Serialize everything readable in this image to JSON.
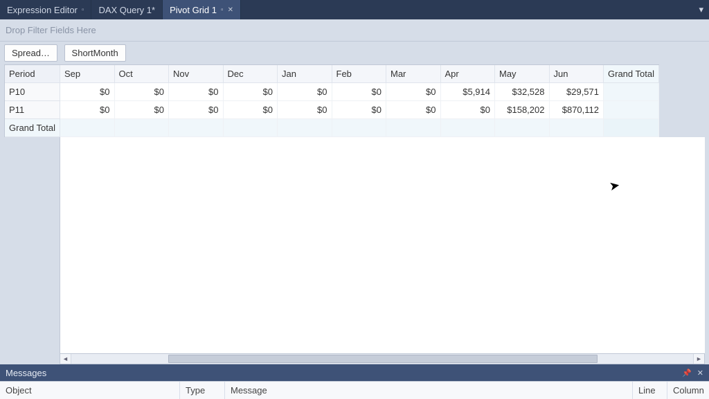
{
  "tabs": [
    {
      "label": "Expression Editor",
      "active": false,
      "pinned": true,
      "closable": false
    },
    {
      "label": "DAX Query 1*",
      "active": false,
      "pinned": false,
      "closable": false
    },
    {
      "label": "Pivot Grid 1",
      "active": true,
      "pinned": true,
      "closable": true
    }
  ],
  "filter_placeholder": "Drop Filter Fields Here",
  "column_field": "ShortMonth",
  "data_field": "Spread…",
  "row_field": "Period",
  "columns": [
    "Sep",
    "Oct",
    "Nov",
    "Dec",
    "Jan",
    "Feb",
    "Mar",
    "Apr",
    "May",
    "Jun"
  ],
  "grand_total_label": "Grand Total",
  "rows": [
    {
      "label": "P10",
      "values": [
        "$0",
        "$0",
        "$0",
        "$0",
        "$0",
        "$0",
        "$0",
        "$5,914",
        "$32,528",
        "$29,571"
      ],
      "gt": ""
    },
    {
      "label": "P11",
      "values": [
        "$0",
        "$0",
        "$0",
        "$0",
        "$0",
        "$0",
        "$0",
        "$0",
        "$158,202",
        "$870,112"
      ],
      "gt": ""
    }
  ],
  "grand_total_row": {
    "label": "Grand Total",
    "values": [
      "",
      "",
      "",
      "",
      "",
      "",
      "",
      "",
      "",
      ""
    ],
    "gt": ""
  },
  "messages": {
    "title": "Messages",
    "cols": {
      "object": "Object",
      "type": "Type",
      "message": "Message",
      "line": "Line",
      "column": "Column"
    }
  }
}
